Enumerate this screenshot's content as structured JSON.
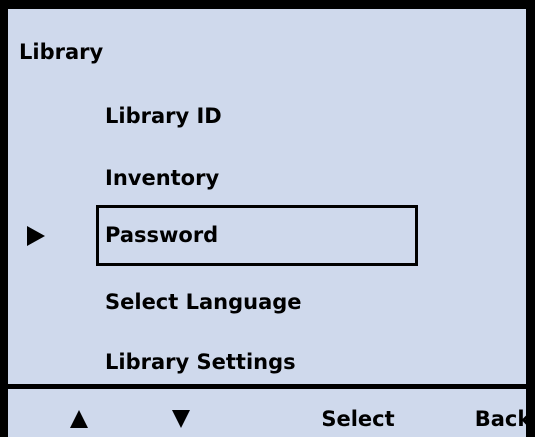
{
  "screen": {
    "title": "Library"
  },
  "menu": {
    "items": [
      {
        "label": "Library ID"
      },
      {
        "label": "Inventory"
      },
      {
        "label": "Password"
      },
      {
        "label": "Select Language"
      },
      {
        "label": "Library Settings"
      }
    ],
    "selected_index": 2
  },
  "softkeys": {
    "up_icon": "up-arrow-icon",
    "down_icon": "down-arrow-icon",
    "select_label": "Select",
    "back_label": "Back"
  },
  "colors": {
    "screen_background": "#cfd9ec",
    "text": "#000000",
    "frame": "#000000"
  }
}
